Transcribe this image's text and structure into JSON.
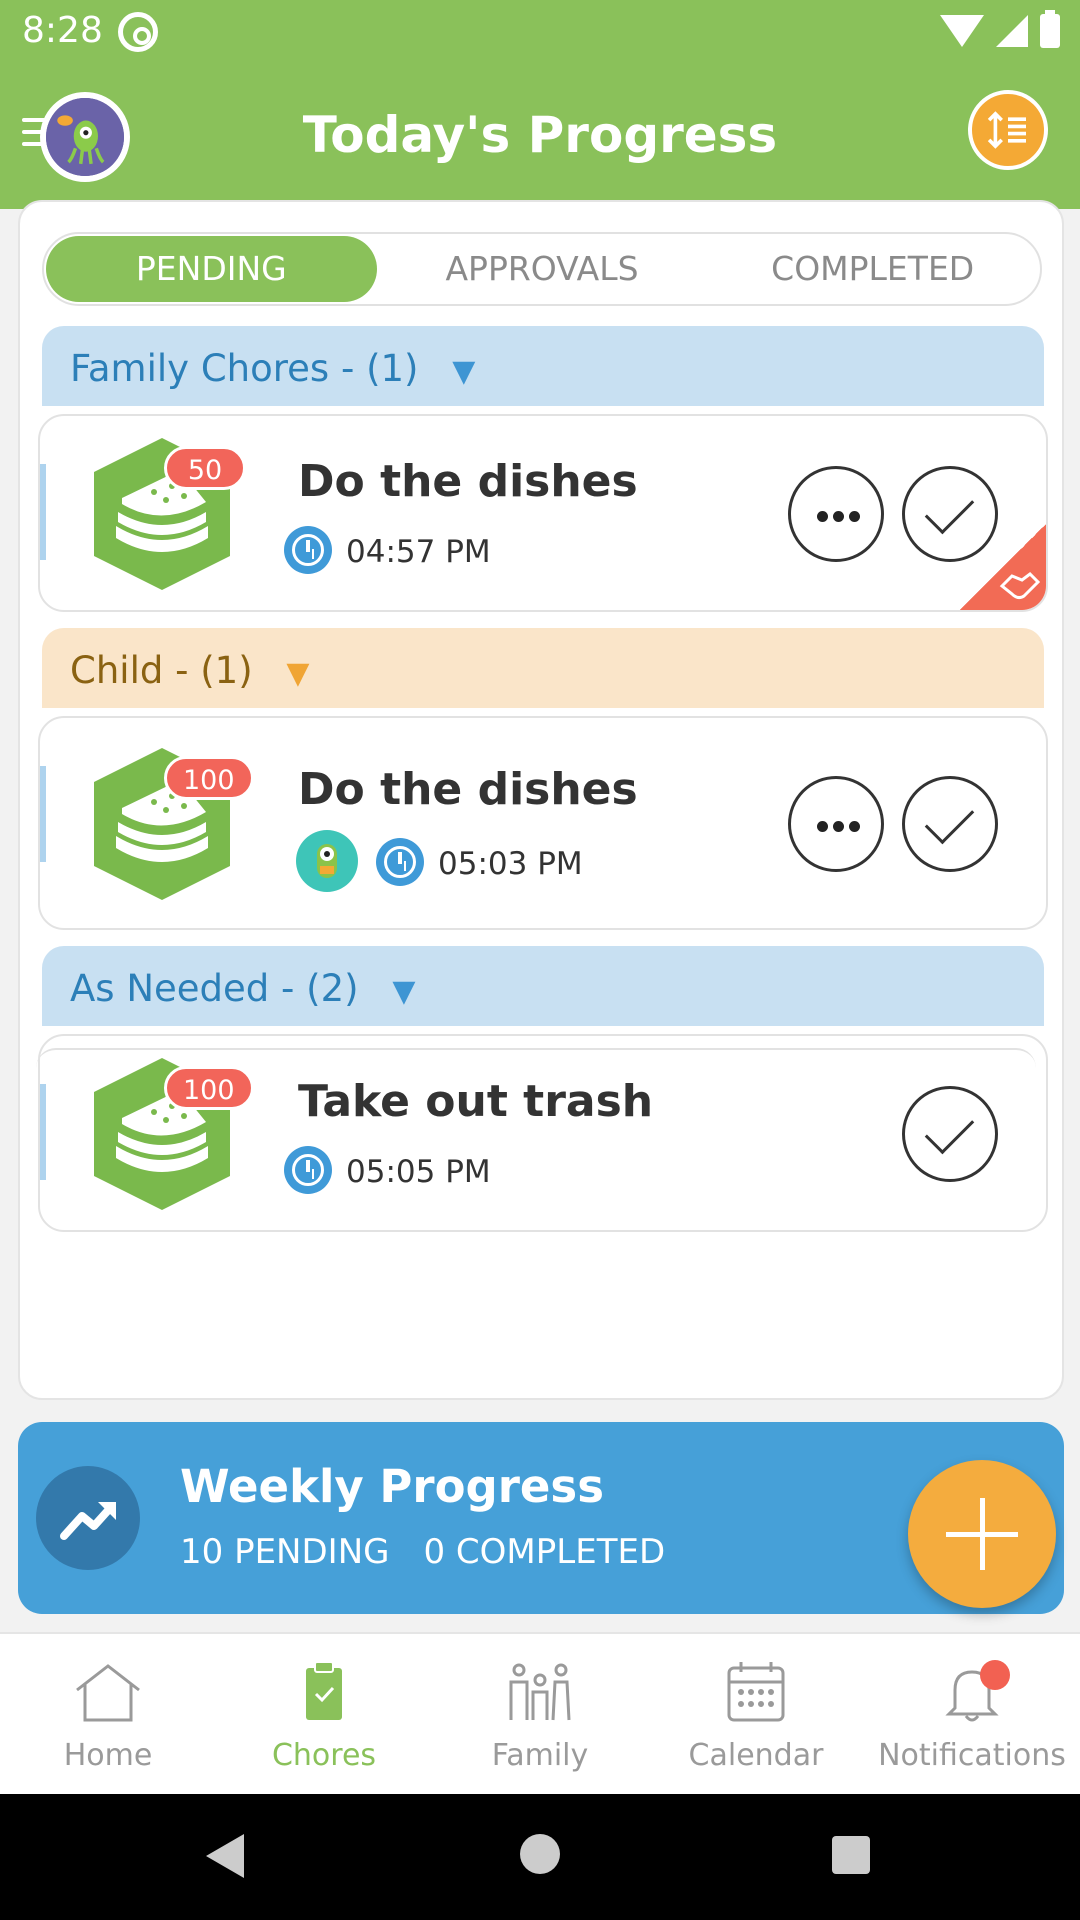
{
  "status_bar": {
    "time": "8:28"
  },
  "header": {
    "title": "Today's Progress"
  },
  "tabs": [
    {
      "label": "PENDING",
      "active": true
    },
    {
      "label": "APPROVALS",
      "active": false
    },
    {
      "label": "COMPLETED",
      "active": false
    }
  ],
  "sections": [
    {
      "title": "Family Chores -",
      "count": "(1)",
      "color": "#c8e0f2",
      "chores": [
        {
          "title": "Do the dishes",
          "points": "50",
          "time": "04:57 PM",
          "shared": true
        }
      ]
    },
    {
      "title": "Child -",
      "count": "(1)",
      "color": "#fae5c9",
      "chores": [
        {
          "title": "Do the dishes",
          "points": "100",
          "time": "05:03 PM",
          "assignee_avatar": "alien-avatar"
        }
      ]
    },
    {
      "title": "As Needed -",
      "count": "(2)",
      "color": "#c8e0f2",
      "chores": [
        {
          "title": "Take out trash",
          "points": "100",
          "time": "05:05 PM"
        }
      ]
    }
  ],
  "weekly": {
    "title": "Weekly Progress",
    "pending": "10 PENDING",
    "completed": "0 COMPLETED"
  },
  "bottom_nav": [
    {
      "label": "Home",
      "icon": "home-icon",
      "active": false
    },
    {
      "label": "Chores",
      "icon": "clipboard-icon",
      "active": true
    },
    {
      "label": "Family",
      "icon": "family-icon",
      "active": false
    },
    {
      "label": "Calendar",
      "icon": "calendar-icon",
      "active": false
    },
    {
      "label": "Notifications",
      "icon": "bell-icon",
      "active": false
    }
  ],
  "colors": {
    "brand_green": "#8ac15a",
    "accent_orange": "#f4ac3e",
    "blue": "#46a0d8",
    "badge_red": "#f2655a"
  }
}
